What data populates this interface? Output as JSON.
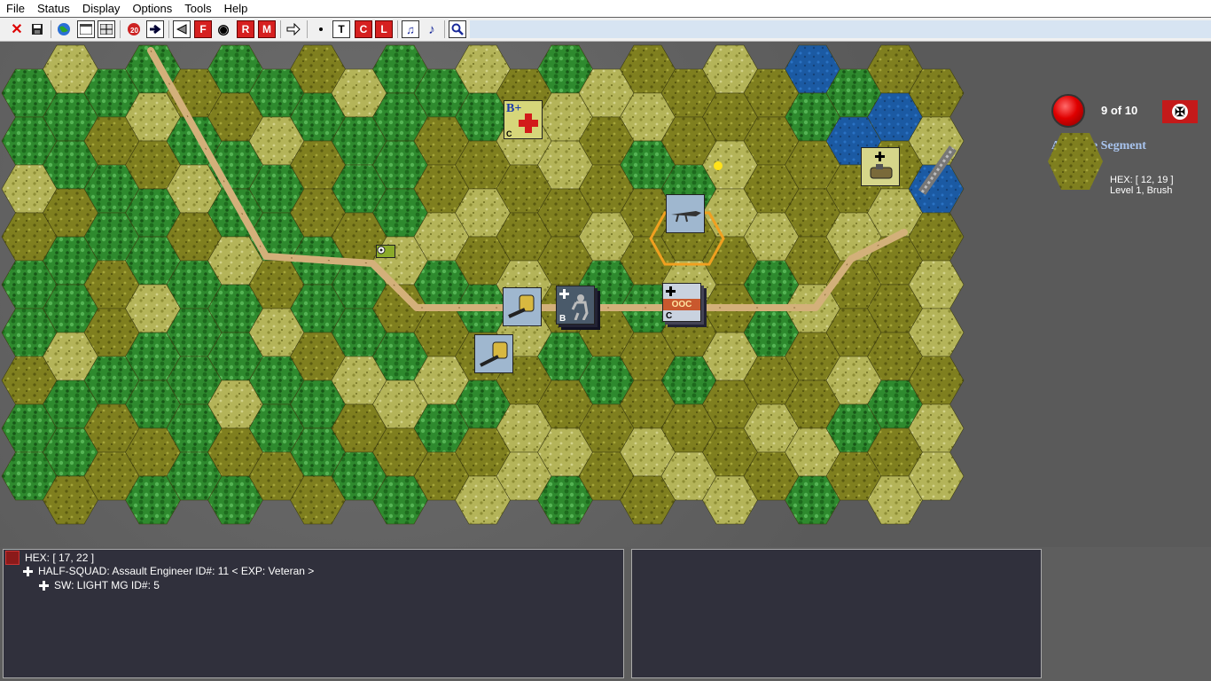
{
  "menu": {
    "file": "File",
    "status": "Status",
    "display": "Display",
    "options": "Options",
    "tools": "Tools",
    "help": "Help"
  },
  "toolbar": {
    "f_label": "F",
    "r_label": "R",
    "m_label": "M",
    "t_label": "T",
    "c_label": "C",
    "l_label": "L"
  },
  "turn": {
    "text": "9 of 10"
  },
  "phase": {
    "segment": "Advance Segment"
  },
  "hex_info": {
    "hex": "HEX: [ 12, 19 ]",
    "terrain": "Level 1, Brush"
  },
  "counters": {
    "medic_b": "B+",
    "medic_c": "C",
    "squad_b": "B",
    "stack_c": "C",
    "stack_label": "OOC"
  },
  "info_panel": {
    "hex": "HEX: [ 17, 22 ]",
    "unit": "HALF-SQUAD: Assault Engineer   ID#: 11 < EXP: Veteran >",
    "weapon": "SW: LIGHT MG  ID#: 5"
  },
  "colors": {
    "map_bg": "#5e5e5e",
    "panel_bg": "#30303c",
    "segment_text": "#a8c4ee"
  }
}
